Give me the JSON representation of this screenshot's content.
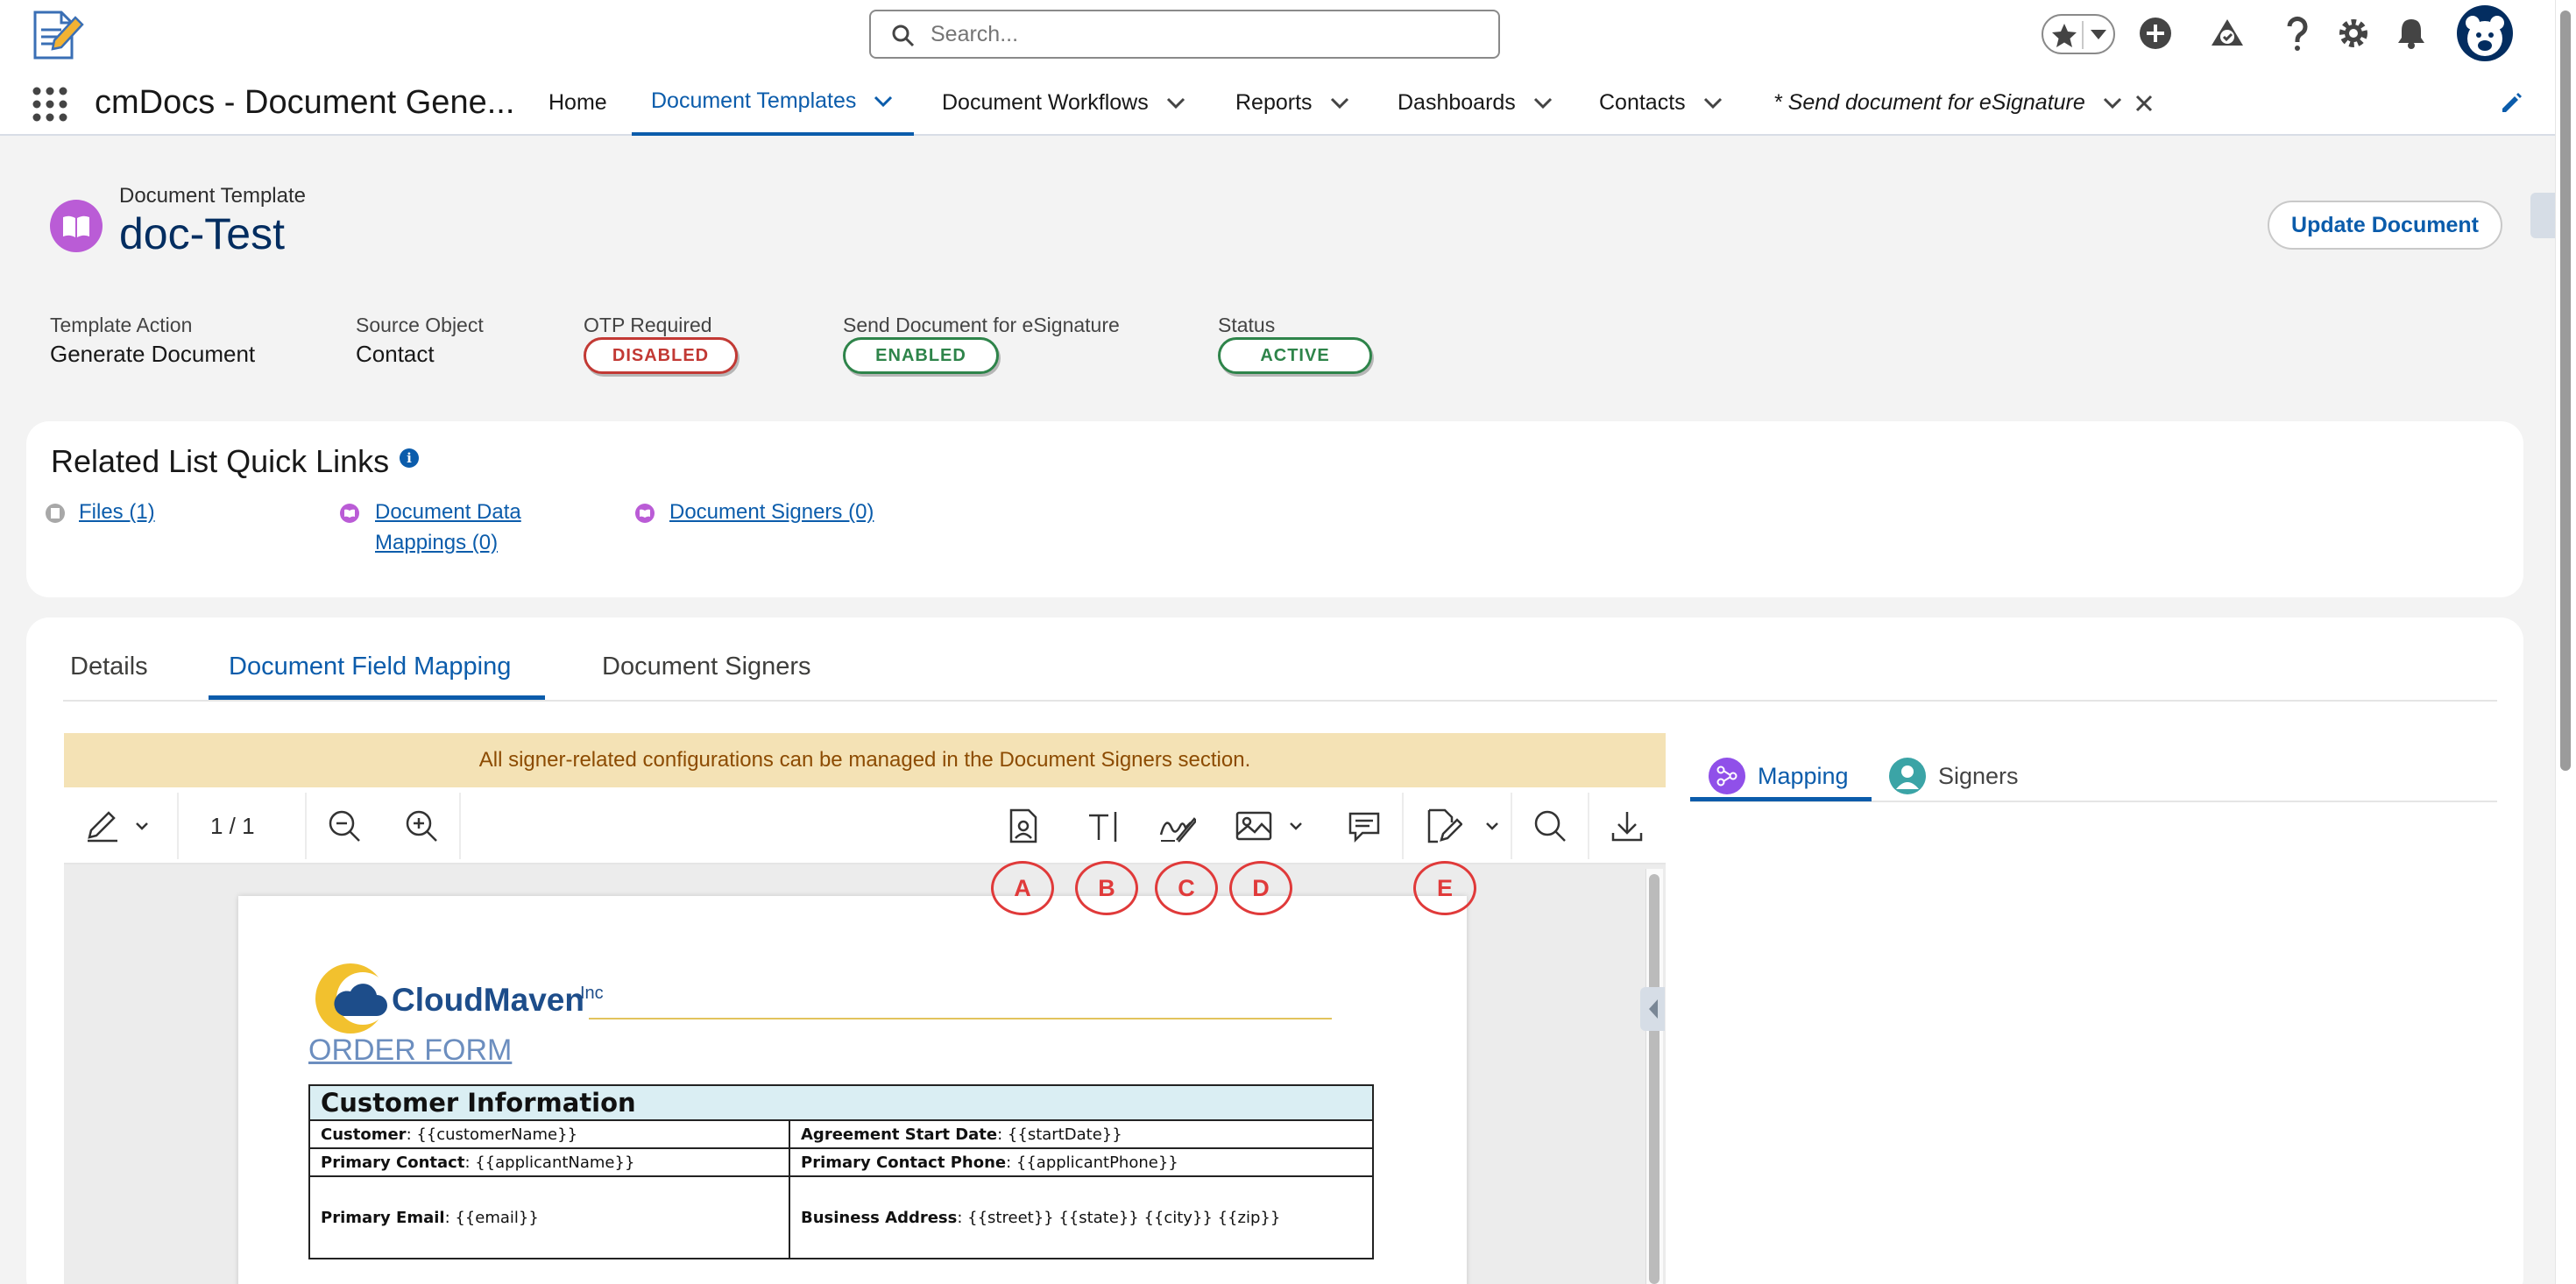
{
  "header": {
    "search_placeholder": "Search...",
    "icons": [
      "favorites-star-icon",
      "favorites-dropdown-icon",
      "global-actions-plus-icon",
      "trailhead-icon",
      "help-icon",
      "setup-gear-icon",
      "notifications-bell-icon",
      "user-avatar"
    ]
  },
  "nav": {
    "app_name": "cmDocs - Document Gene...",
    "items": [
      {
        "label": "Home",
        "has_menu": false
      },
      {
        "label": "Document Templates",
        "has_menu": true,
        "active": true
      },
      {
        "label": "Document Workflows",
        "has_menu": true
      },
      {
        "label": "Reports",
        "has_menu": true
      },
      {
        "label": "Dashboards",
        "has_menu": true
      },
      {
        "label": "Contacts",
        "has_menu": true
      },
      {
        "label": "* Send document for eSignature",
        "has_menu": true,
        "closable": true,
        "italic": true
      }
    ]
  },
  "record": {
    "type_label": "Document Template",
    "title": "doc-Test",
    "update_button": "Update Document",
    "fields": [
      {
        "label": "Template Action",
        "value": "Generate Document"
      },
      {
        "label": "Source Object",
        "value": "Contact"
      },
      {
        "label": "OTP Required",
        "badge": "DISABLED",
        "badge_color": "#c23934"
      },
      {
        "label": "Send Document for eSignature",
        "badge": "ENABLED",
        "badge_color": "#2e844a"
      },
      {
        "label": "Status",
        "badge": "ACTIVE",
        "badge_color": "#2e844a"
      }
    ]
  },
  "related_links": {
    "title": "Related List Quick Links",
    "info_icon": "i",
    "links": [
      {
        "label": "Files (1)"
      },
      {
        "label_line1": "Document Data",
        "label_line2": "Mappings (0)"
      },
      {
        "label": "Document Signers (0)"
      }
    ]
  },
  "tabs": {
    "items": [
      "Details",
      "Document Field Mapping",
      "Document Signers"
    ],
    "active": "Document Field Mapping"
  },
  "mapping": {
    "banner": "All signer-related configurations can be managed in the Document Signers section.",
    "page_indicator": "1 / 1",
    "toolbar_icons": [
      "annotate-pen-icon",
      "zoom-out-icon",
      "zoom-in-icon",
      "contact-card-field-icon",
      "text-field-icon",
      "signature-field-icon",
      "image-field-icon",
      "comment-icon",
      "edit-field-icon",
      "search-icon",
      "download-icon"
    ],
    "markers": [
      "A",
      "B",
      "C",
      "D",
      "E"
    ]
  },
  "document": {
    "brand": "CloudMaven",
    "brand_suffix": "Inc",
    "heading": "ORDER FORM",
    "table_title": "Customer Information",
    "rows": [
      [
        {
          "label": "Customer",
          "value": ": {{customerName}}"
        },
        {
          "label": "Agreement Start Date",
          "value": ": {{startDate}}"
        }
      ],
      [
        {
          "label": "Primary Contact",
          "value": ": {{applicantName}}"
        },
        {
          "label": "Primary Contact Phone",
          "value": ": {{applicantPhone}}"
        }
      ],
      [
        {
          "label": "Primary Email",
          "value": ": {{email}}"
        },
        {
          "label": "Business Address",
          "value": ": {{street}} {{state}} {{city}} {{zip}}"
        }
      ]
    ]
  },
  "side_panel": {
    "tabs": [
      "Mapping",
      "Signers"
    ],
    "active": "Mapping"
  },
  "colors": {
    "brand_blue": "#0b5cab",
    "record_icon": "#ba5cd6",
    "banner_bg": "#f4e2b5",
    "marker_red": "#e03a3a"
  }
}
